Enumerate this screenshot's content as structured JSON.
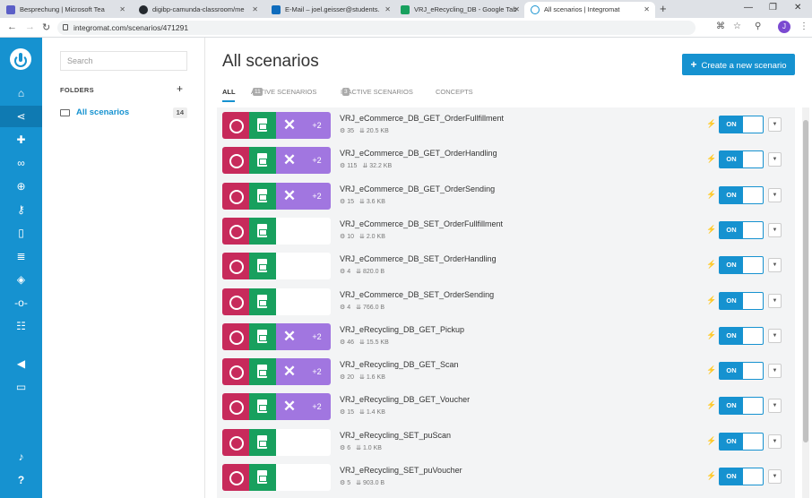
{
  "browser": {
    "tabs": [
      {
        "label": "Besprechung | Microsoft Tea",
        "color": "#5b5fc7"
      },
      {
        "label": "digibp-camunda-classroom/me",
        "color": "#24292e"
      },
      {
        "label": "E-Mail – joel.geisser@students.",
        "color": "#0f6cbd"
      },
      {
        "label": "VRJ_eRecycling_DB - Google Tab",
        "color": "#18a05e"
      },
      {
        "label": "All scenarios | Integromat",
        "color": "#1692d0"
      }
    ],
    "url": "integromat.com/scenarios/471291",
    "avatar": "J"
  },
  "sidebar_icons": [
    "home-icon",
    "share-icon",
    "puzzle-icon",
    "link-icon",
    "globe-icon",
    "key-icon",
    "device-icon",
    "database-icon",
    "cube-icon",
    "flow-icon",
    "team-icon",
    "megaphone-icon",
    "chat-icon",
    "bell-icon",
    "help-icon"
  ],
  "folders": {
    "search_placeholder": "Search",
    "heading": "FOLDERS",
    "add": "+",
    "items": [
      {
        "label": "All scenarios",
        "count": "14"
      }
    ]
  },
  "main": {
    "title": "All scenarios",
    "create_label": "Create a new scenario",
    "tabs": {
      "all": "ALL",
      "active": "ACTIVE SCENARIOS",
      "active_count": "11",
      "inactive": "INACTIVE SCENARIOS",
      "inactive_count": "3",
      "concepts": "CONCEPTS"
    },
    "scenarios": [
      {
        "name": "VRJ_eCommerce_DB_GET_OrderFullfillment",
        "ops": "35",
        "size": "20.5 KB",
        "extra": "+2",
        "status": "ON"
      },
      {
        "name": "VRJ_eCommerce_DB_GET_OrderHandling",
        "ops": "115",
        "size": "32.2 KB",
        "extra": "+2",
        "status": "ON"
      },
      {
        "name": "VRJ_eCommerce_DB_GET_OrderSending",
        "ops": "15",
        "size": "3.6 KB",
        "extra": "+2",
        "status": "ON"
      },
      {
        "name": "VRJ_eCommerce_DB_SET_OrderFullfillment",
        "ops": "10",
        "size": "2.0 KB",
        "extra": "",
        "status": "ON"
      },
      {
        "name": "VRJ_eCommerce_DB_SET_OrderHandling",
        "ops": "4",
        "size": "820.0 B",
        "extra": "",
        "status": "ON"
      },
      {
        "name": "VRJ_eCommerce_DB_SET_OrderSending",
        "ops": "4",
        "size": "766.0 B",
        "extra": "",
        "status": "ON"
      },
      {
        "name": "VRJ_eRecycling_DB_GET_Pickup",
        "ops": "46",
        "size": "15.5 KB",
        "extra": "+2",
        "status": "ON"
      },
      {
        "name": "VRJ_eRecycling_DB_GET_Scan",
        "ops": "20",
        "size": "1.6 KB",
        "extra": "+2",
        "status": "ON"
      },
      {
        "name": "VRJ_eRecycling_DB_GET_Voucher",
        "ops": "15",
        "size": "1.4 KB",
        "extra": "+2",
        "status": "ON"
      },
      {
        "name": "VRJ_eRecycling_SET_puScan",
        "ops": "6",
        "size": "1.0 KB",
        "extra": "",
        "status": "ON"
      },
      {
        "name": "VRJ_eRecycling_SET_puVoucher",
        "ops": "5",
        "size": "903.0 B",
        "extra": "",
        "status": "ON"
      }
    ]
  }
}
